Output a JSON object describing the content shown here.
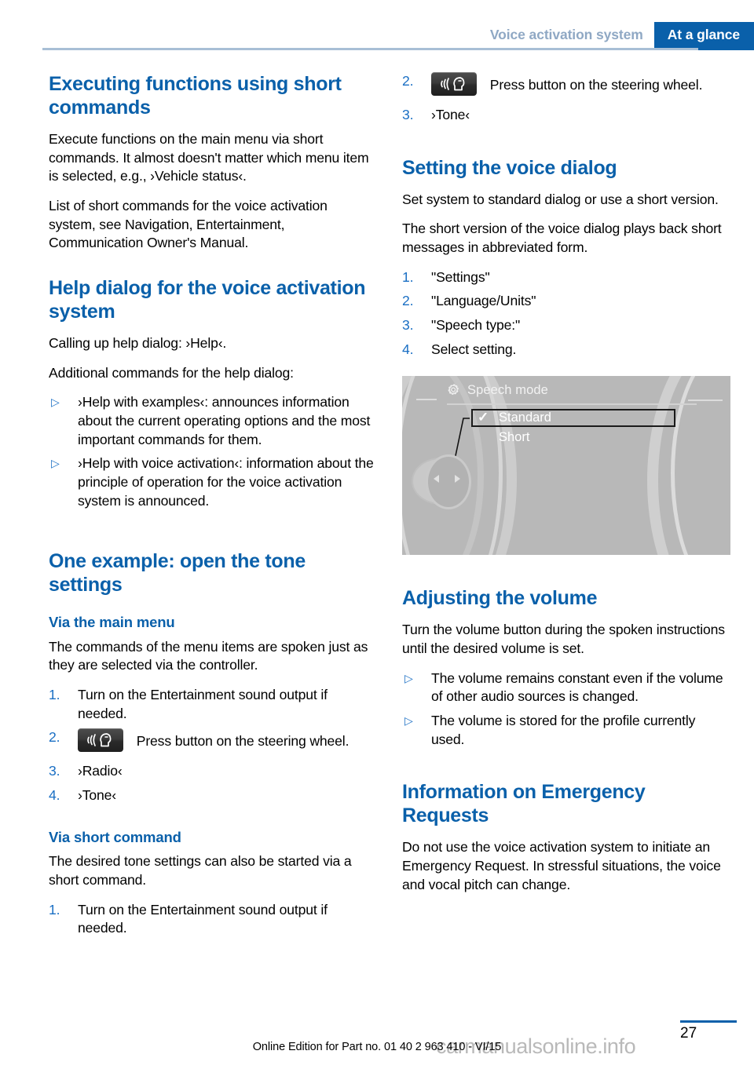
{
  "header": {
    "chapter": "Voice activation system",
    "section": "At a glance",
    "accent_color": "#0a60aa",
    "chapter_color": "#8fa8c4"
  },
  "left_column": {
    "heading_1": "Executing functions using short commands",
    "para_1": "Execute functions on the main menu via short commands. It almost doesn't matter which menu item is selected, e.g., ›Vehicle status‹.",
    "para_2": "List of short commands for the voice activation system, see Navigation, Entertainment, Communication Owner's Manual.",
    "heading_2": "Help dialog for the voice activation system",
    "para_3": "Calling up help dialog: ›Help‹.",
    "para_4": "Additional commands for the help dialog:",
    "bullets_1": [
      "›Help with examples‹: announces information about the current operating options and the most important commands for them.",
      "›Help with voice activation‹: information about the principle of operation for the voice activation system is announced."
    ],
    "heading_3": "One example: open the tone settings",
    "subheading_1": "Via the main menu",
    "para_5": "The commands of the menu items are spoken just as they are selected via the controller.",
    "steps_1": [
      {
        "num": "1.",
        "text": "Turn on the Entertainment sound output if needed.",
        "icon": null
      },
      {
        "num": "2.",
        "text": "Press button on the steering wheel.",
        "icon": "speech-button-icon"
      },
      {
        "num": "3.",
        "text": "›Radio‹",
        "icon": null
      },
      {
        "num": "4.",
        "text": "›Tone‹",
        "icon": null
      }
    ],
    "subheading_2": "Via short command",
    "para_6": "The desired tone settings can also be started via a short command.",
    "steps_2": [
      {
        "num": "1.",
        "text": "Turn on the Entertainment sound output if needed.",
        "icon": null
      }
    ]
  },
  "right_column": {
    "steps_continued": [
      {
        "num": "2.",
        "text": "Press button on the steering wheel.",
        "icon": "speech-button-icon"
      },
      {
        "num": "3.",
        "text": "›Tone‹",
        "icon": null
      }
    ],
    "heading_1": "Setting the voice dialog",
    "para_1": "Set system to standard dialog or use a short version.",
    "para_2": "The short version of the voice dialog plays back short messages in abbreviated form.",
    "steps_1": [
      {
        "num": "1.",
        "text": "\"Settings\""
      },
      {
        "num": "2.",
        "text": "\"Language/Units\""
      },
      {
        "num": "3.",
        "text": "\"Speech type:\""
      },
      {
        "num": "4.",
        "text": "Select setting."
      }
    ],
    "idrive_screen": {
      "title": "Speech mode",
      "title_icon": "gear-icon",
      "items": [
        {
          "label": "Standard",
          "checked": true,
          "selected": true,
          "check_glyph": "✓"
        },
        {
          "label": "Short",
          "checked": false,
          "selected": false
        }
      ],
      "controller_left_arrow": "◀",
      "controller_right_arrow": "▶"
    },
    "heading_2": "Adjusting the volume",
    "para_3": "Turn the volume button during the spoken instructions until the desired volume is set.",
    "bullets_1": [
      "The volume remains constant even if the volume of other audio sources is changed.",
      "The volume is stored for the profile currently used."
    ],
    "heading_3": "Information on Emergency Requests",
    "para_4": "Do not use the voice activation system to initiate an Emergency Request. In stressful situations, the voice and vocal pitch can change."
  },
  "footer": {
    "page_number": "27",
    "note": "Online Edition for Part no. 01 40 2 963 410 - VI/15",
    "watermark": "carmanualsonline.info"
  },
  "markers": {
    "bullet": "▷"
  }
}
